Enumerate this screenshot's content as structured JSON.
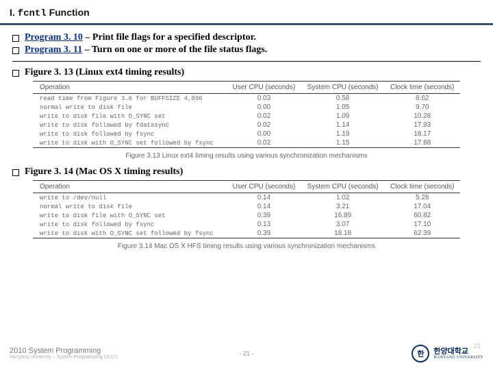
{
  "title": {
    "prefix": "I.",
    "code": "fcntl",
    "suffix": " Function"
  },
  "bullets": {
    "b1_link": "Program 3. 10",
    "b1_rest": " – Print file flags for a specified descriptor.",
    "b2_link": "Program 3. 11",
    "b2_rest": " – Turn on one or more of the file status flags.",
    "b3": "Figure 3. 13 (Linux ext4 timing results)",
    "b4": "Figure 3. 14 (Mac OS X timing results)"
  },
  "tableCols": {
    "c1": "Operation",
    "c2": "User CPU (seconds)",
    "c3": "System CPU (seconds)",
    "c4": "Clock time (seconds)"
  },
  "chart_data": [
    {
      "type": "table",
      "caption": "Figure 3.13   Linux ext4 timing results using various synchronization mechanisms",
      "rows": [
        {
          "op": "read time from Figure 3.6 for BUFFSIZE 4,096",
          "user": "0.03",
          "sys": "0.58",
          "clock": "8.62"
        },
        {
          "op": "normal write to disk file",
          "user": "0.00",
          "sys": "1.05",
          "clock": "9.70"
        },
        {
          "op": "write to disk file with O_SYNC set",
          "user": "0.02",
          "sys": "1.09",
          "clock": "10.28"
        },
        {
          "op": "write to disk followed by fdatasync",
          "user": "0.02",
          "sys": "1.14",
          "clock": "17.93"
        },
        {
          "op": "write to disk followed by fsync",
          "user": "0.00",
          "sys": "1.19",
          "clock": "18.17"
        },
        {
          "op": "write to disk with O_SYNC set followed by fsync",
          "user": "0.02",
          "sys": "1.15",
          "clock": "17.88"
        }
      ]
    },
    {
      "type": "table",
      "caption": "Figure 3.14   Mac OS X HFS timing results using various synchronization mechanisms",
      "rows": [
        {
          "op": "write to /dev/null",
          "user": "0.14",
          "sys": "1.02",
          "clock": "5.28"
        },
        {
          "op": "normal write to disk file",
          "user": "0.14",
          "sys": "3.21",
          "clock": "17.04"
        },
        {
          "op": "write to disk file with O_SYNC set",
          "user": "0.39",
          "sys": "16.89",
          "clock": "60.82"
        },
        {
          "op": "write to disk followed by fsync",
          "user": "0.13",
          "sys": "3.07",
          "clock": "17.10"
        },
        {
          "op": "write to disk with O_SYNC set followed by fsync",
          "user": "0.39",
          "sys": "18.18",
          "clock": "62.39"
        }
      ]
    }
  ],
  "footer": {
    "line1": "2010 System Programming",
    "line2": "Hanyang University – System Programming (2017)",
    "page": "- 21 -",
    "hint": "21",
    "logo_text": "한양대학교",
    "logo_sub": "HANYANG UNIVERSITY",
    "logo_mark": "한"
  }
}
